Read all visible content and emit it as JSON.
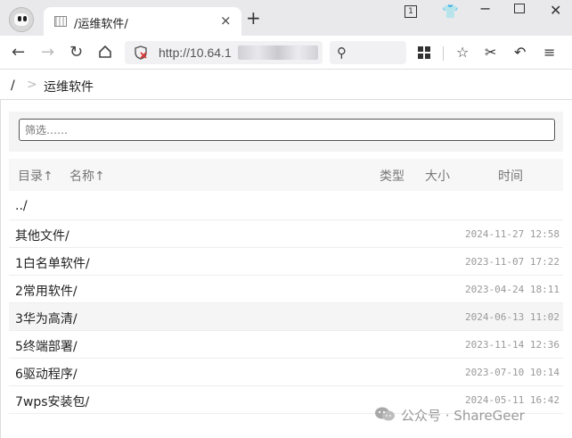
{
  "browser": {
    "tab_title": "/运维软件/",
    "tab_close": "×",
    "new_tab": "+",
    "window_buttons": [
      "1",
      "👕",
      "−",
      "□",
      "✕"
    ],
    "url_visible": "http://10.64.1",
    "search_icon": "search-icon"
  },
  "breadcrumb": {
    "root": "/",
    "separator": ">",
    "current": "运维软件"
  },
  "filter": {
    "placeholder": "筛选……"
  },
  "table": {
    "headers": {
      "dir": "目录↑",
      "name": "名称↑",
      "type": "类型",
      "size": "大小",
      "time": "时间"
    },
    "rows": [
      {
        "name": "../",
        "time": ""
      },
      {
        "name": "其他文件/",
        "time": "2024-11-27 12:58"
      },
      {
        "name": "1白名单软件/",
        "time": "2023-11-07 17:22"
      },
      {
        "name": "2常用软件/",
        "time": "2023-04-24 18:11"
      },
      {
        "name": "3华为高清/",
        "time": "2024-06-13 11:02"
      },
      {
        "name": "5终端部署/",
        "time": "2023-11-14 12:36"
      },
      {
        "name": "6驱动程序/",
        "time": "2023-07-10 10:14"
      },
      {
        "name": "7wps安装包/",
        "time": "2024-05-11 16:42"
      }
    ]
  },
  "watermark": {
    "text": "公众号 · ShareGeer"
  }
}
